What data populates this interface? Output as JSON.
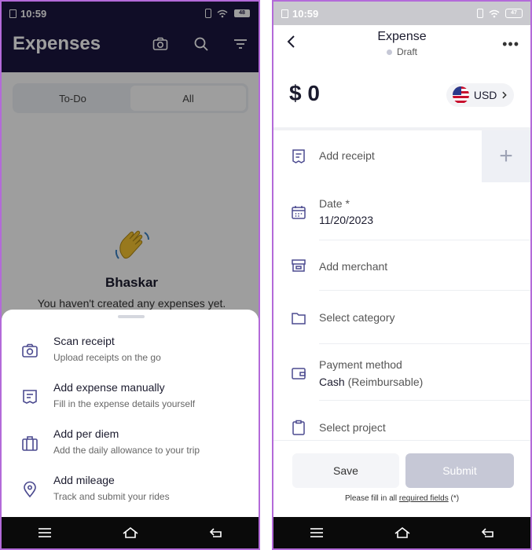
{
  "left": {
    "status": {
      "time": "10:59",
      "battery": "48"
    },
    "header": {
      "title": "Expenses"
    },
    "tabs": [
      {
        "label": "To-Do",
        "active": false
      },
      {
        "label": "All",
        "active": true
      }
    ],
    "empty": {
      "name": "Bhaskar",
      "message": "You haven't created any expenses yet."
    },
    "sheet": {
      "items": [
        {
          "title": "Scan receipt",
          "subtitle": "Upload receipts on the go",
          "icon": "camera-icon"
        },
        {
          "title": "Add expense manually",
          "subtitle": "Fill in the expense details yourself",
          "icon": "receipt-icon"
        },
        {
          "title": "Add per diem",
          "subtitle": "Add the daily allowance to your trip",
          "icon": "luggage-icon"
        },
        {
          "title": "Add mileage",
          "subtitle": "Track and submit your rides",
          "icon": "location-pin-icon"
        }
      ]
    }
  },
  "right": {
    "status": {
      "time": "10:59",
      "battery": "47"
    },
    "header": {
      "title": "Expense",
      "status": "Draft"
    },
    "amount": "$ 0",
    "currency": "USD",
    "fields": {
      "receipt": {
        "label": "Add receipt"
      },
      "date": {
        "label": "Date *",
        "value": "11/20/2023"
      },
      "merchant": {
        "label": "Add merchant"
      },
      "category": {
        "label": "Select category"
      },
      "payment": {
        "label": "Payment method",
        "value": "Cash",
        "value_note": "(Reimbursable)"
      },
      "project": {
        "label": "Select project"
      }
    },
    "footer": {
      "save": "Save",
      "submit": "Submit",
      "note_prefix": "Please fill in all",
      "note_link": "required fields",
      "note_suffix": "(*)"
    }
  },
  "colors": {
    "header_dark": "#1b1540",
    "accent_icon": "#4b4a8f",
    "submit_disabled": "#c6c8d6"
  }
}
